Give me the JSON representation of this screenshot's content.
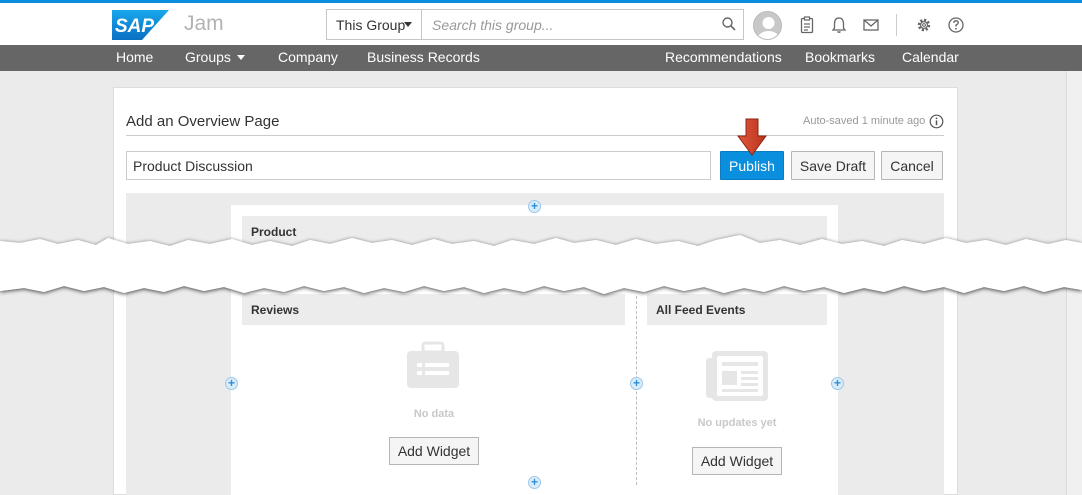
{
  "header": {
    "logo_text": "SAP",
    "app_name": "Jam",
    "search_scope": "This Group",
    "search_placeholder": "Search this group..."
  },
  "nav": {
    "left": [
      "Home",
      "Groups",
      "Company",
      "Business Records"
    ],
    "right": [
      "Recommendations",
      "Bookmarks",
      "Calendar"
    ]
  },
  "editor": {
    "heading": "Add an Overview Page",
    "autosave": "Auto-saved 1 minute ago",
    "title_value": "Product Discussion",
    "publish_label": "Publish",
    "save_draft_label": "Save Draft",
    "cancel_label": "Cancel"
  },
  "widgets": {
    "top_section_title": "Product",
    "reviews": {
      "title": "Reviews",
      "empty_text": "No data",
      "button_label": "Add Widget"
    },
    "feed": {
      "title": "All Feed Events",
      "empty_text": "No updates yet",
      "button_label": "Add Widget"
    },
    "add_marker": "+"
  },
  "colors": {
    "accent": "#0a8fde",
    "nav_bg": "#666666",
    "arrow": "#d8432b"
  }
}
